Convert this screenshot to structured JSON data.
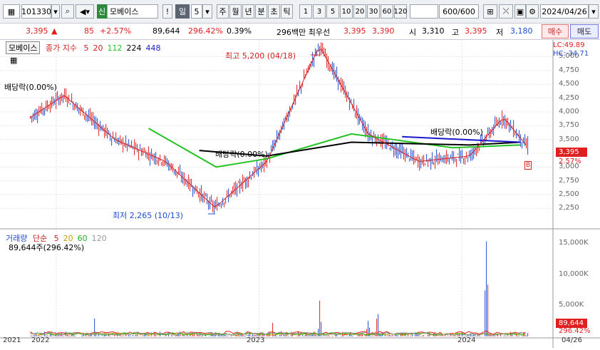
{
  "toolbar": {
    "code": "101330",
    "market_badge": "신",
    "name": "모베이스",
    "period_selected": "일",
    "period_num": "5",
    "periods": [
      "주",
      "월",
      "년",
      "분",
      "초",
      "틱"
    ],
    "intervals": [
      "1",
      "3",
      "5",
      "10",
      "20",
      "30",
      "60",
      "120"
    ],
    "count": "600",
    "count_total": "/600",
    "date": "2024/04/26"
  },
  "status": {
    "price": "3,395",
    "change_arrow": "▲",
    "change": "85",
    "change_pct": "+2.57%",
    "volume": "89,644",
    "vol_ratio": "296.42%",
    "turnover": "0.39%",
    "amount_label": "296백만 최우선",
    "ask": "3,395",
    "bid": "3,390",
    "open_label": "시",
    "open": "3,310",
    "high_label": "고",
    "high": "3,395",
    "low_label": "저",
    "low": "3,180",
    "buy_label": "매수",
    "sell_label": "매도"
  },
  "price_panel": {
    "chip": "모베이스",
    "legend_title": "종가 지수",
    "ma_labels": [
      "5",
      "20",
      "112",
      "224",
      "448"
    ],
    "ma_colors": [
      "#d02020",
      "#d02020",
      "#22c322",
      "#000000",
      "#1a1acc"
    ],
    "lc": "LC:49.89",
    "hc": "HC:-34.71",
    "max_label": "최고 5,200 (04/18)",
    "min_label": "최저 2,265 (10/13)",
    "div_labels": [
      "배당락(0.00%)",
      "배당락(0.00%)",
      "배당락(0.00%)"
    ],
    "y_ticks": [
      "5,000",
      "4,750",
      "4,500",
      "4,250",
      "4,000",
      "3,750",
      "3,500",
      "3,250",
      "3,000",
      "2,750",
      "2,500",
      "2,250"
    ],
    "price_tag": "3,395",
    "pct_tag": "2.57%",
    "marker_b": "B"
  },
  "volume_panel": {
    "title": "거래량",
    "ma_label": "단순",
    "ma_values": [
      "5",
      "20",
      "60",
      "120"
    ],
    "ma_colors": [
      "#e02020",
      "#c9a000",
      "#22aa22",
      "#999999"
    ],
    "info": "89,644주(296.42%)",
    "y_ticks": [
      "15,000K",
      "10,000K",
      "5,000K"
    ],
    "vol_tag": "89,644",
    "vol_pct": "296.42%"
  },
  "x_labels": [
    "2021",
    "2022",
    "2023",
    "2024",
    "04/26"
  ],
  "colors": {
    "up": "#e02020",
    "down": "#1f4fd1",
    "ma5": "#d02020",
    "ma112": "#22c322",
    "ma224": "#000000",
    "ma448": "#1a1acc"
  },
  "chart_data": {
    "type": "line",
    "series": [
      {
        "name": "종가",
        "x": [
          "2021-11",
          "2022-01",
          "2022-04",
          "2022-07",
          "2022-10-13",
          "2023-01",
          "2023-04-18",
          "2023-07",
          "2023-10",
          "2024-01",
          "2024-03",
          "2024-04-26"
        ],
        "values": [
          3900,
          4300,
          3500,
          3100,
          2265,
          3100,
          5200,
          3600,
          3100,
          3200,
          3900,
          3395
        ]
      },
      {
        "name": "112",
        "x": [
          "2022-06",
          "2022-10",
          "2023-01",
          "2023-06",
          "2023-12",
          "2024-04"
        ],
        "values": [
          3700,
          3000,
          3150,
          3600,
          3350,
          3400
        ]
      },
      {
        "name": "224",
        "x": [
          "2022-09",
          "2023-01",
          "2023-06",
          "2024-01",
          "2024-04"
        ],
        "values": [
          3300,
          3200,
          3450,
          3400,
          3450
        ]
      },
      {
        "name": "448",
        "x": [
          "2023-09",
          "2024-04"
        ],
        "values": [
          3550,
          3450
        ]
      }
    ],
    "ylim": [
      2100,
      5200
    ],
    "volume_peaks_K": [
      {
        "x": "2023-04-18",
        "v": 6800
      },
      {
        "x": "2023-07",
        "v": 2600
      },
      {
        "x": "2024-02",
        "v": 15700
      }
    ],
    "volume_ylim_K": [
      0,
      16000
    ]
  }
}
